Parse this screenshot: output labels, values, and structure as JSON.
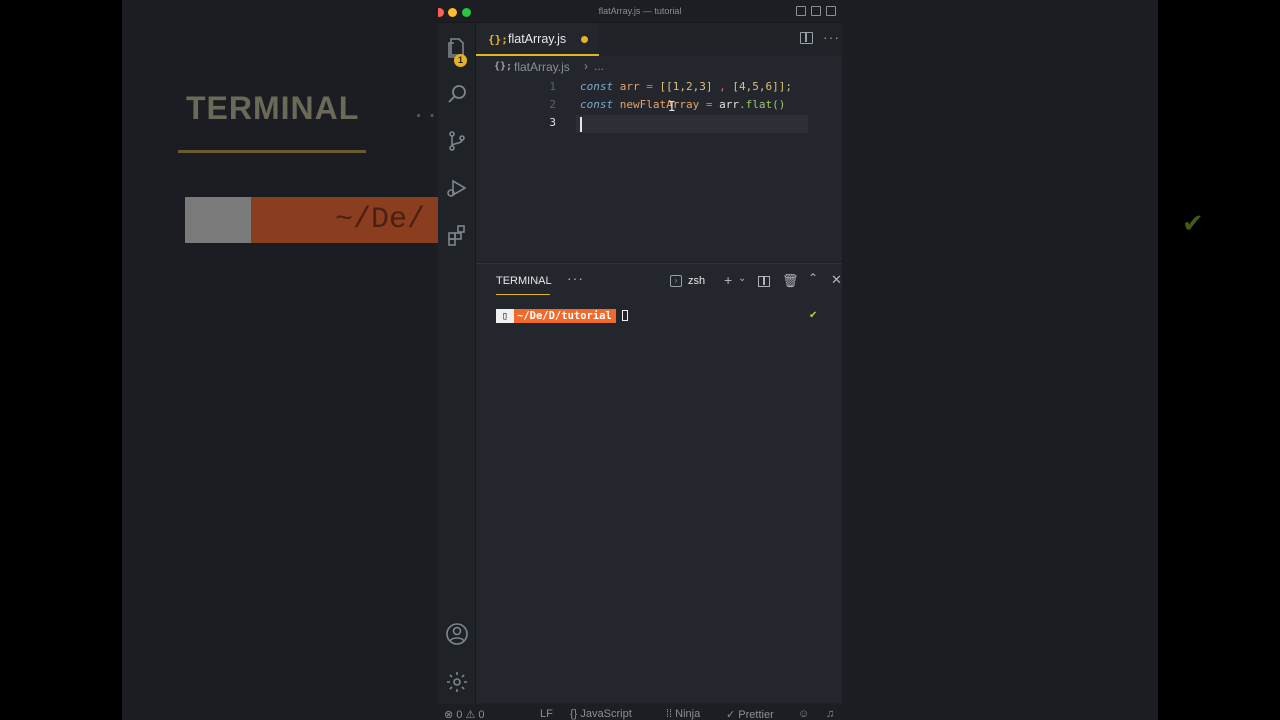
{
  "background": {
    "title": "TERMINAL",
    "prompt_path": "~/De/"
  },
  "window": {
    "title": "flatArray.js — tutorial"
  },
  "activity_bar": {
    "explorer_badge": "1"
  },
  "editor": {
    "tab_label": "flatArray.js",
    "tab_icon": "{};",
    "breadcrumb_file": "flatArray.js",
    "breadcrumb_more": "...",
    "lines": [
      {
        "number": "1",
        "keyword": "const",
        "var": "arr",
        "op": "=",
        "rest_a": "[[1,2,3]",
        "rest_b": " , ",
        "rest_c": "[4,5,6]];"
      },
      {
        "number": "2",
        "keyword": "const",
        "var": "newFlatArray",
        "op": "=",
        "obj": "arr",
        "fn": ".flat()"
      },
      {
        "number": "3"
      }
    ]
  },
  "panel": {
    "tab_label": "TERMINAL",
    "more": "···",
    "terminal_kind": "zsh",
    "prompt_path": " ~/De/D/tutorial ",
    "check": "✔"
  },
  "status_bar": {
    "errors": "⊗ 0 ⚠ 0",
    "eol": "LF",
    "language": "{} JavaScript",
    "ninja": "⁞⁞ Ninja",
    "prettier": "✓ Prettier"
  },
  "colors": {
    "accent": "#e6b422",
    "prompt_orange": "#f06a2b"
  }
}
